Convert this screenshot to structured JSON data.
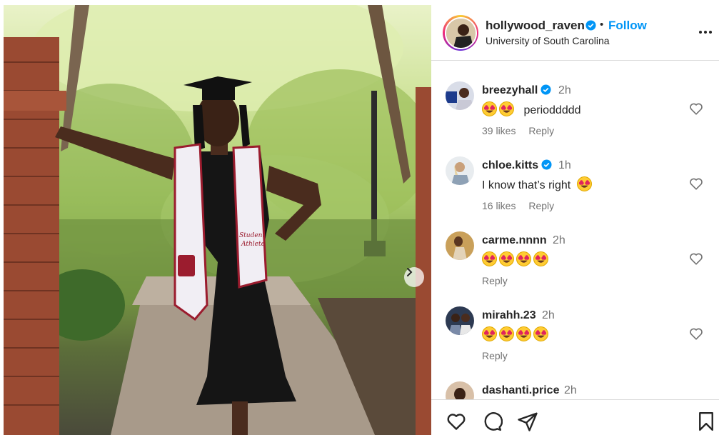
{
  "post": {
    "username": "hollywood_raven",
    "separator": "•",
    "follow_label": "Follow",
    "location": "University of South Carolina",
    "stole_text_line1": "Student",
    "stole_text_line2": "Athlete"
  },
  "comments": [
    {
      "username": "breezyhall",
      "verified": true,
      "time": "2h",
      "emojis": 2,
      "text": "perioddddd",
      "likes": "39 likes",
      "reply": "Reply"
    },
    {
      "username": "chloe.kitts",
      "verified": true,
      "time": "1h",
      "emojis_after": 1,
      "text": "I know that’s right",
      "likes": "16 likes",
      "reply": "Reply"
    },
    {
      "username": "carme.nnnn",
      "verified": false,
      "time": "2h",
      "emojis": 4,
      "text": "",
      "reply": "Reply"
    },
    {
      "username": "mirahh.23",
      "verified": false,
      "time": "2h",
      "emojis": 4,
      "text": "",
      "reply": "Reply"
    },
    {
      "username": "dashanti.price",
      "verified": false,
      "time": "2h"
    }
  ],
  "icons": {
    "verified": "verified-badge-icon",
    "more": "more-options-icon",
    "like": "heart-icon",
    "comment": "comment-icon",
    "share": "share-icon",
    "save": "bookmark-icon",
    "next": "chevron-right-icon",
    "emoji": "heart-eyes-emoji"
  },
  "colors": {
    "link": "#0095f6",
    "verified": "#0095f6",
    "text": "#262626",
    "muted": "#737373",
    "border": "#dbdbdb"
  }
}
